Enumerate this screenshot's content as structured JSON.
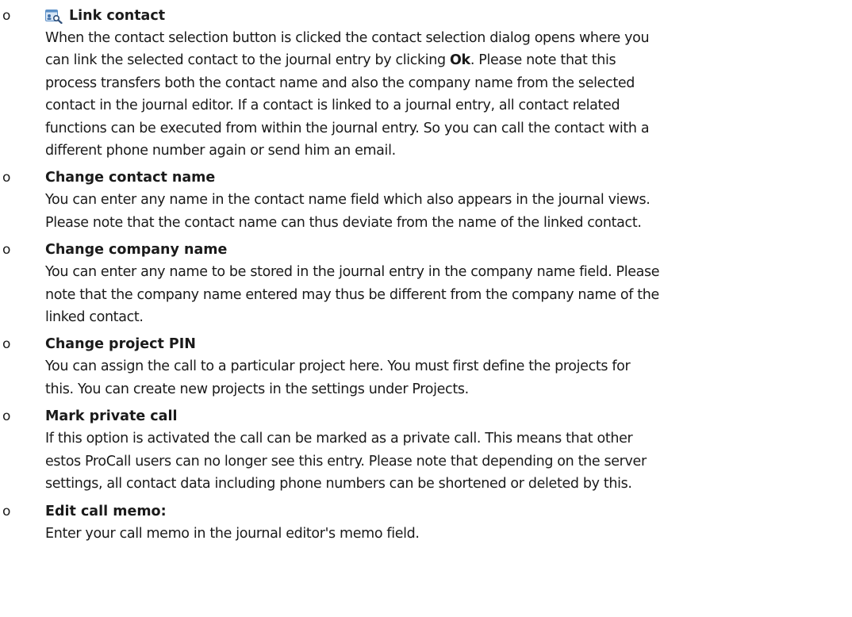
{
  "items": [
    {
      "bullet": "o",
      "title": "Link contact",
      "icon": "contact-link-icon",
      "desc_before": "When the contact selection button is clicked the contact selection dialog opens where you\ncan link the selected contact to the journal entry by clicking ",
      "desc_bold": "Ok",
      "desc_after": ". Please note that this\nprocess transfers both the contact name and also the company name from the selected\ncontact in the journal editor. If a contact is linked to a journal entry, all contact related\nfunctions can be executed from within the journal entry. So you can call the contact with a\ndifferent phone number again or send him an email."
    },
    {
      "bullet": "o",
      "title": "Change contact name",
      "desc": "You can enter any name in the contact name field which also appears in the journal views.\nPlease note that the contact name can thus deviate from the name of the linked contact."
    },
    {
      "bullet": "o",
      "title": "Change company name",
      "desc": "You can enter any name to be stored in the journal entry in the company name field. Please\nnote that the company name entered may thus be different from the company name of the\nlinked contact."
    },
    {
      "bullet": "o",
      "title": "Change project PIN",
      "desc": "You can assign the call to a particular project here. You must first define the projects for\nthis. You can create new projects in the settings under Projects."
    },
    {
      "bullet": "o",
      "title": "Mark private call",
      "desc": "If this option is activated the call can be marked as a private call. This means that other\nestos ProCall users can no longer see this entry. Please note that depending on the server\nsettings, all contact data including phone numbers can be shortened or deleted by this."
    },
    {
      "bullet": "o",
      "title": "Edit call memo:",
      "desc": "Enter your call memo in the journal editor's memo field."
    }
  ]
}
